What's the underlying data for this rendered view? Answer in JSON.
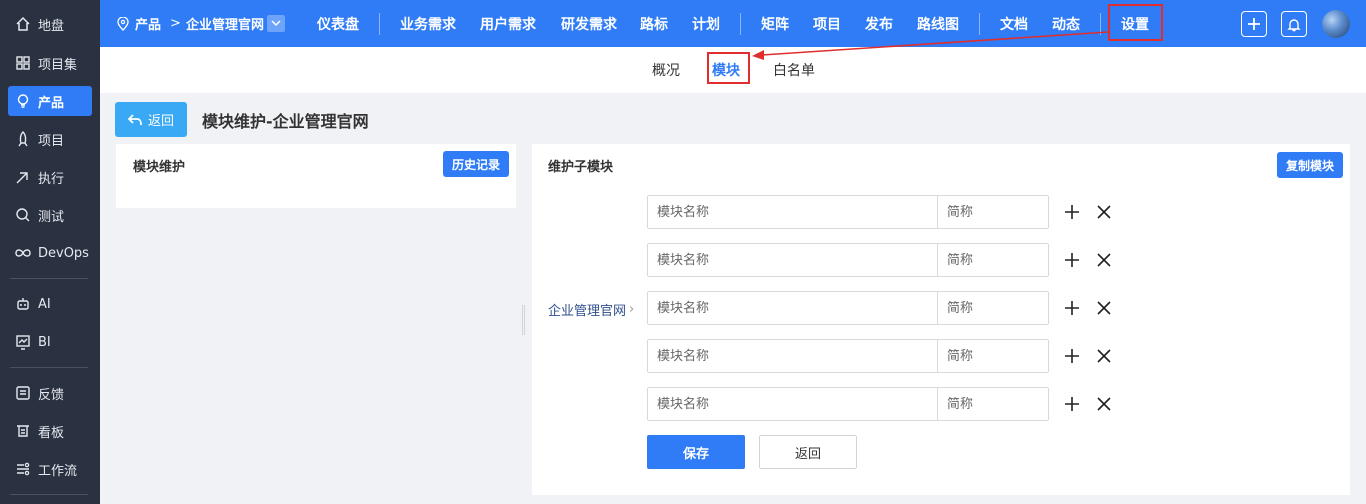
{
  "sidebar": {
    "items": [
      {
        "label": "地盘",
        "icon": "home-icon",
        "active": false
      },
      {
        "label": "项目集",
        "icon": "grid-icon",
        "active": false
      },
      {
        "label": "产品",
        "icon": "bulb-icon",
        "active": true
      },
      {
        "label": "项目",
        "icon": "rocket-icon",
        "active": false
      },
      {
        "label": "执行",
        "icon": "run-icon",
        "active": false
      },
      {
        "label": "测试",
        "icon": "search-icon",
        "active": false
      },
      {
        "label": "DevOps",
        "icon": "infinity-icon",
        "active": false
      },
      {
        "label": "AI",
        "icon": "robot-icon",
        "active": false
      },
      {
        "label": "BI",
        "icon": "chart-icon",
        "active": false
      },
      {
        "label": "反馈",
        "icon": "feedback-icon",
        "active": false
      },
      {
        "label": "看板",
        "icon": "board-icon",
        "active": false
      },
      {
        "label": "工作流",
        "icon": "workflow-icon",
        "active": false
      }
    ]
  },
  "topnav": {
    "breadcrumb_root": "产品",
    "breadcrumb_sep": ">",
    "breadcrumb_current": "企业管理官网",
    "items": [
      "仪表盘",
      "业务需求",
      "用户需求",
      "研发需求",
      "路标",
      "计划",
      "矩阵",
      "项目",
      "发布",
      "路线图",
      "文档",
      "动态",
      "设置"
    ],
    "highlighted": "设置"
  },
  "subtabs": {
    "items": [
      "概况",
      "模块",
      "白名单"
    ],
    "active": "模块"
  },
  "header": {
    "back_label": "返回",
    "page_title": "模块维护-企业管理官网"
  },
  "left_panel": {
    "title": "模块维护",
    "history_label": "历史记录"
  },
  "right_panel": {
    "title": "维护子模块",
    "copy_label": "复制模块",
    "parent_label": "企业管理官网",
    "parent_chevron": "›",
    "rows": [
      {
        "name_placeholder": "模块名称",
        "short_placeholder": "简称"
      },
      {
        "name_placeholder": "模块名称",
        "short_placeholder": "简称"
      },
      {
        "name_placeholder": "模块名称",
        "short_placeholder": "简称"
      },
      {
        "name_placeholder": "模块名称",
        "short_placeholder": "简称"
      },
      {
        "name_placeholder": "模块名称",
        "short_placeholder": "简称"
      }
    ],
    "save_label": "保存",
    "return_label": "返回"
  },
  "colors": {
    "primary": "#2f7cf6",
    "sidebar_bg": "#2a3140",
    "annotation_red": "#e02d2d",
    "back_button": "#39a8f5"
  }
}
